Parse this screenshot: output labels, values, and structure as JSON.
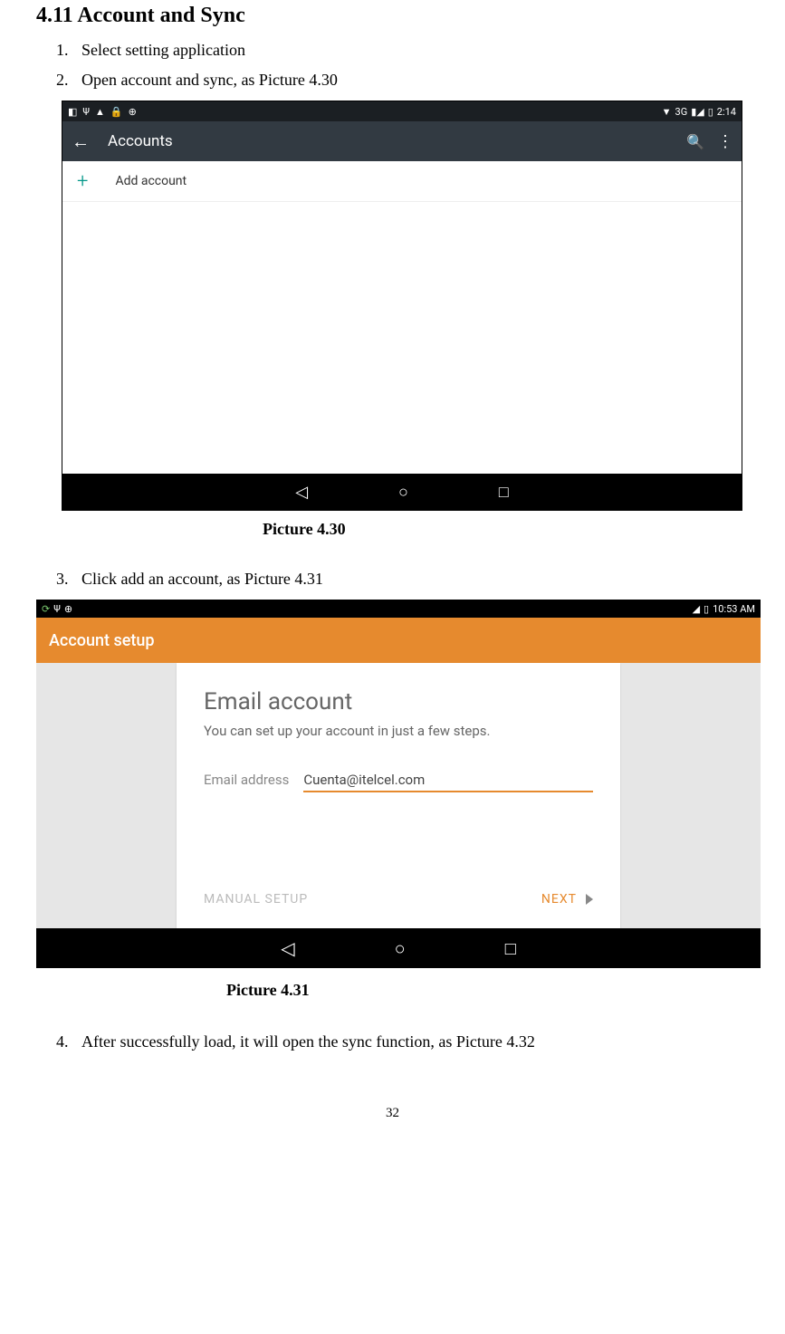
{
  "section": {
    "heading": "4.11 Account and Sync",
    "steps": [
      "Select setting application",
      "Open account and sync, as Picture 4.30",
      "Click add an account, as Picture 4.31",
      "After successfully load, it will open the sync function, as Picture 4.32"
    ]
  },
  "captions": {
    "p430": "Picture 4.30",
    "p431": "Picture 4.31"
  },
  "screenshot1": {
    "status": {
      "network": "3G",
      "signal": "▮◢",
      "battery": "▯",
      "time": "2:14"
    },
    "appbar": {
      "title": "Accounts"
    },
    "row": {
      "label": "Add account"
    }
  },
  "screenshot2": {
    "status": {
      "battery": "▯",
      "signal": "◢",
      "time": "10:53 AM"
    },
    "header": "Account setup",
    "card": {
      "title": "Email account",
      "subtitle": "You can set up your account in just a few steps.",
      "email_label": "Email address",
      "email_value": "Cuenta@itelcel.com"
    },
    "actions": {
      "manual": "MANUAL SETUP",
      "next": "NEXT"
    }
  },
  "page_number": "32"
}
